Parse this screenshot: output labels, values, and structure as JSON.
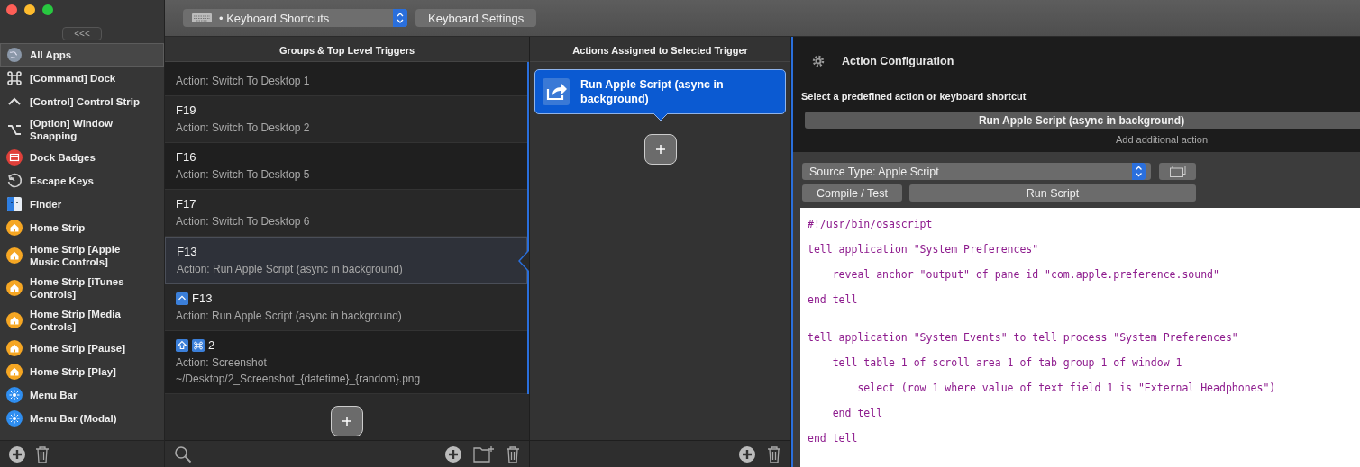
{
  "sidebar": {
    "collapse_button": "<<<",
    "items": [
      {
        "label": "All Apps",
        "kind": "globe",
        "selected": true
      },
      {
        "label": "[Command] Dock",
        "kind": "command",
        "selected": false
      },
      {
        "label": "[Control] Control Strip",
        "kind": "control",
        "selected": false
      },
      {
        "label": "[Option] Window Snapping",
        "kind": "option",
        "selected": false
      },
      {
        "label": "Dock Badges",
        "kind": "badge",
        "selected": false
      },
      {
        "label": "Escape Keys",
        "kind": "escape",
        "selected": false
      },
      {
        "label": "Finder",
        "kind": "finder",
        "selected": false
      },
      {
        "label": "Home Strip",
        "kind": "home",
        "selected": false
      },
      {
        "label": "Home Strip [Apple Music Controls]",
        "kind": "home",
        "selected": false
      },
      {
        "label": "Home Strip [iTunes Controls]",
        "kind": "home",
        "selected": false
      },
      {
        "label": "Home Strip [Media Controls]",
        "kind": "home",
        "selected": false
      },
      {
        "label": "Home Strip [Pause]",
        "kind": "home",
        "selected": false
      },
      {
        "label": "Home Strip [Play]",
        "kind": "home",
        "selected": false
      },
      {
        "label": "Menu Bar",
        "kind": "menubar",
        "selected": false
      },
      {
        "label": "Menu Bar (Modal)",
        "kind": "menubar",
        "selected": false
      }
    ]
  },
  "toolbar": {
    "preset_popup": "• Keyboard Shortcuts",
    "settings_button": "Keyboard Settings"
  },
  "triggers": {
    "header": "Groups & Top Level Triggers",
    "rows": [
      {
        "action": "Action: Switch To Desktop 1",
        "selected": false
      },
      {
        "title": "F19",
        "action": "Action: Switch To Desktop 2",
        "selected": false
      },
      {
        "title": "F16",
        "action": "Action: Switch To Desktop 5",
        "selected": false
      },
      {
        "title": "F17",
        "action": "Action: Switch To Desktop 6",
        "selected": false
      },
      {
        "title": "F13",
        "action": "Action: Run Apple Script (async in background)",
        "selected": true
      },
      {
        "modifiers": [
          {
            "kind": "control"
          }
        ],
        "title": "F13",
        "action": "Action: Run Apple Script (async in background)",
        "selected": false
      },
      {
        "modifiers": [
          {
            "kind": "shift"
          },
          {
            "kind": "command"
          }
        ],
        "title": "2",
        "action": "Action: Screenshot ~/Desktop/2_Screenshot_{datetime}_{random}.png",
        "selected": false
      }
    ]
  },
  "actions": {
    "header": "Actions Assigned to Selected Trigger",
    "items": [
      {
        "label": "Run Apple Script (async in background)",
        "selected": true
      }
    ]
  },
  "config": {
    "title": "Action Configuration",
    "prompt": "Select a predefined action or keyboard shortcut",
    "action_button": "Run Apple Script (async in background)",
    "add_link": "Add additional action",
    "source_type": "Source Type: Apple Script",
    "compile_button": "Compile / Test",
    "run_button": "Run Script",
    "code_blocks": [
      [
        "#!/usr/bin/osascript",
        "tell application \"System Preferences\"",
        "    reveal anchor \"output\" of pane id \"com.apple.preference.sound\"",
        "end tell"
      ],
      [
        "tell application \"System Events\" to tell process \"System Preferences\"",
        "    tell table 1 of scroll area 1 of tab group 1 of window 1",
        "        select (row 1 where value of text field 1 is \"External Headphones\")",
        "    end tell",
        "end tell"
      ]
    ]
  }
}
